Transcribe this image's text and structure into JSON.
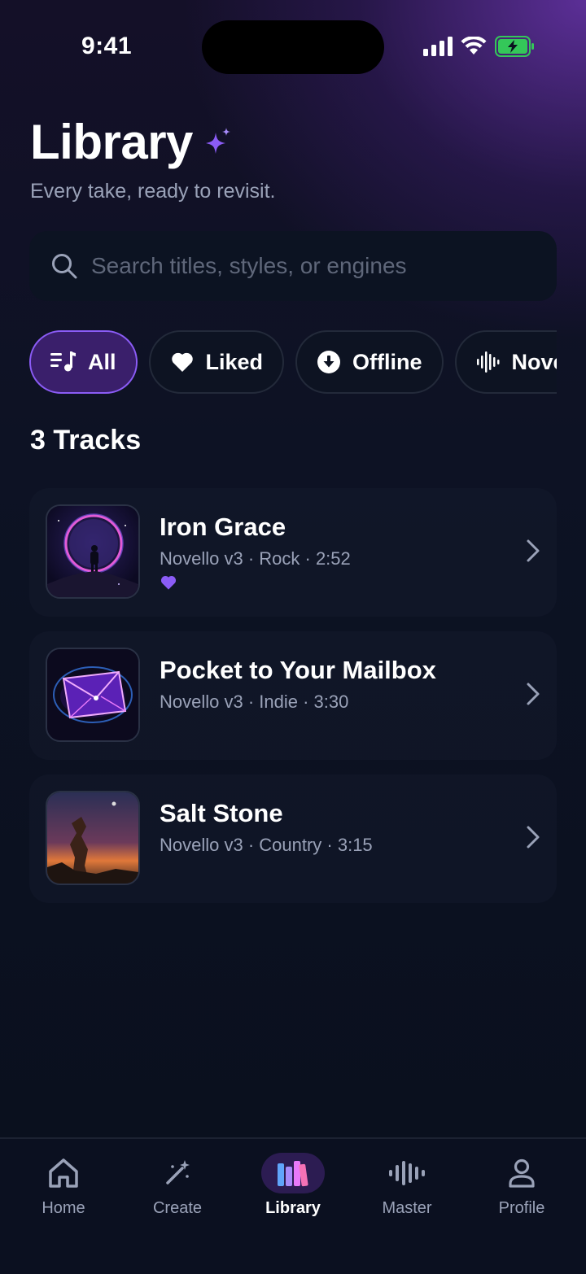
{
  "status_bar": {
    "time": "9:41"
  },
  "header": {
    "title": "Library",
    "subtitle": "Every take, ready to revisit."
  },
  "search": {
    "placeholder": "Search titles, styles, or engines"
  },
  "filters": [
    {
      "label": "All",
      "icon": "music-list-icon",
      "active": true
    },
    {
      "label": "Liked",
      "icon": "heart-icon",
      "active": false
    },
    {
      "label": "Offline",
      "icon": "download-icon",
      "active": false
    },
    {
      "label": "Novello",
      "icon": "waveform-icon",
      "active": false
    }
  ],
  "tracks_count": "3 Tracks",
  "tracks": [
    {
      "title": "Iron Grace",
      "meta": "Novello v3 · Rock · 2:52",
      "liked": true
    },
    {
      "title": "Pocket to Your Mailbox",
      "meta": "Novello v3 · Indie · 3:30",
      "liked": false
    },
    {
      "title": "Salt Stone",
      "meta": "Novello v3 · Country · 3:15",
      "liked": false
    }
  ],
  "tabbar": {
    "home": "Home",
    "create": "Create",
    "library": "Library",
    "master": "Master",
    "profile": "Profile"
  },
  "colors": {
    "accent": "#8b5cf6",
    "background": "#0b1120",
    "muted_text": "#9aa2b8"
  }
}
